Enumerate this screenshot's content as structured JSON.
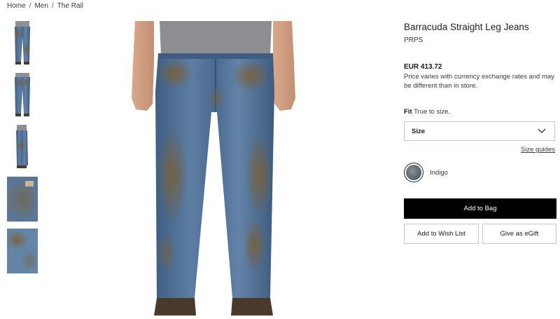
{
  "breadcrumb": {
    "items": [
      "Home",
      "Men",
      "The Rail"
    ],
    "separator": "/"
  },
  "gallery": {
    "thumbnails": [
      "front-full",
      "back-full",
      "side-full",
      "back-pocket-detail",
      "fabric-closeup"
    ],
    "selected_index": 0
  },
  "product": {
    "title": "Barracuda Straight Leg Jeans",
    "brand": "PRPS",
    "price": "EUR 413.72",
    "price_note": "Price varies with currency exchange rates and may be different than in store.",
    "fit_label": "Fit",
    "fit_value": "True to size.",
    "size_select": {
      "label": "Size",
      "icon": "chevron-down-icon"
    },
    "size_guides_label": "Size guides",
    "color": {
      "name": "Indigo",
      "swatch_color": "#5c666b"
    },
    "actions": {
      "add_to_bag": "Add to Bag",
      "add_to_wish_list": "Add to Wish List",
      "give_as_egift": "Give as eGift"
    }
  },
  "colors": {
    "primary_button_bg": "#000000",
    "text": "#191919",
    "border": "#c8c8c8",
    "denim": "#4f6f92",
    "mud": "#7a6038"
  }
}
